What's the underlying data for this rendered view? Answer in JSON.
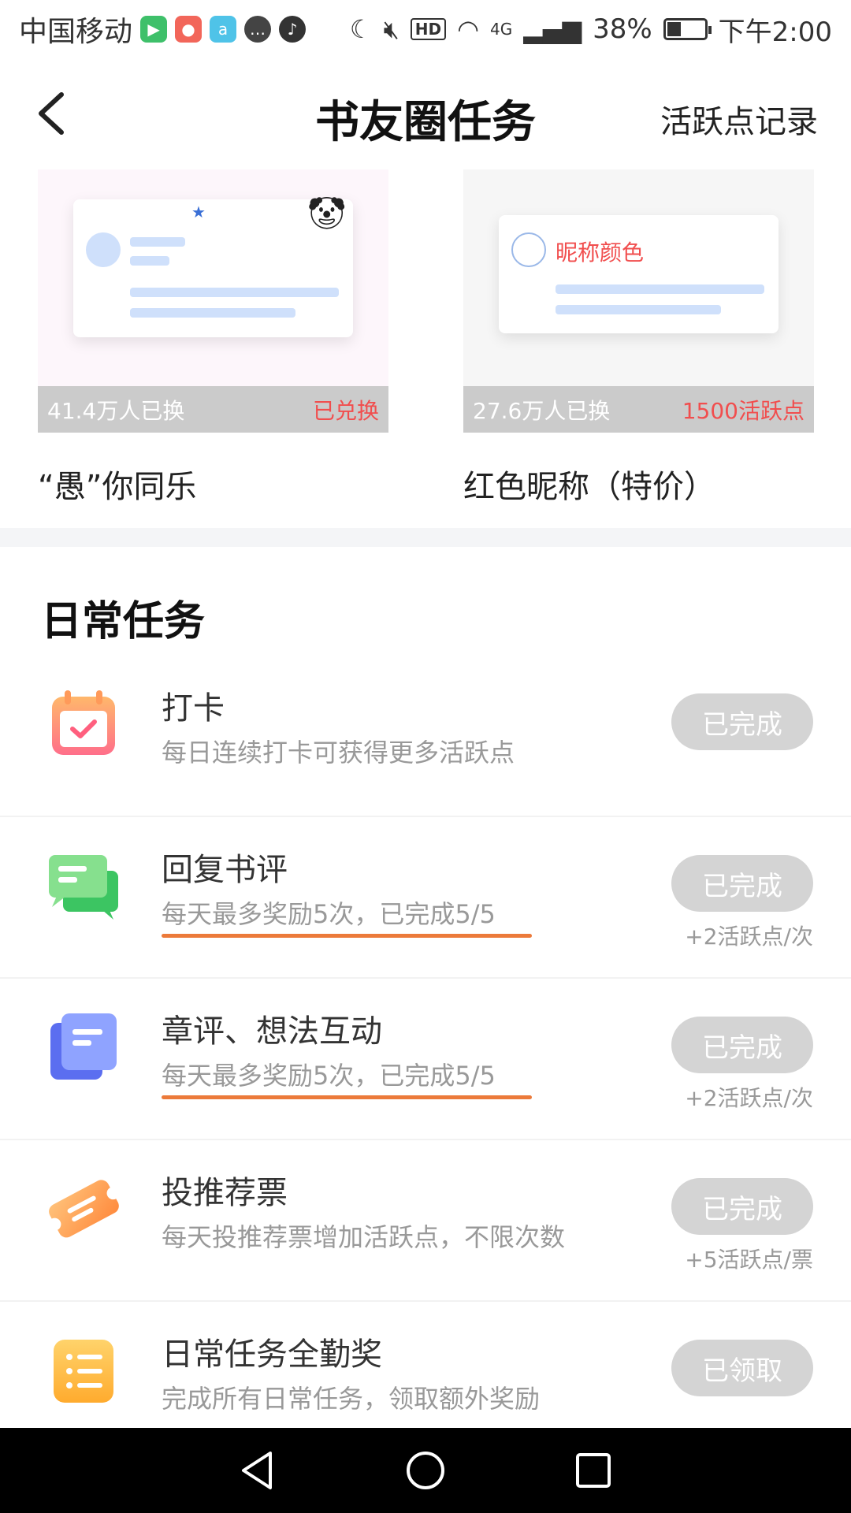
{
  "status_bar": {
    "carrier": "中国移动",
    "network": "4G",
    "battery": "38%",
    "battery_level": 0.38,
    "time": "下午2:00",
    "hd": "HD",
    "app_icons": [
      "video-app-icon",
      "red-app-icon",
      "aha-app-icon",
      "message-icon",
      "tiktok-icon"
    ]
  },
  "header": {
    "title": "书友圈任务",
    "record_link": "活跃点记录"
  },
  "rewards": [
    {
      "preview_label": "",
      "count": "41.4万人已换",
      "status": "已兑换",
      "name": "“愚”你同乐"
    },
    {
      "preview_label": "昵称颜色",
      "count": "27.6万人已换",
      "status": "1500活跃点",
      "name": "红色昵称（特价）"
    }
  ],
  "daily": {
    "title": "日常任务",
    "tasks": [
      {
        "name": "打卡",
        "desc": "每日连续打卡可获得更多活跃点",
        "button": "已完成",
        "reward": "",
        "icon": "calendar-check-icon"
      },
      {
        "name": "回复书评",
        "desc": "每天最多奖励5次，已完成5/5",
        "button": "已完成",
        "reward": "+2活跃点/次",
        "icon": "chat-bubbles-icon"
      },
      {
        "name": "章评、想法互动",
        "desc": "每天最多奖励5次，已完成5/5",
        "button": "已完成",
        "reward": "+2活跃点/次",
        "icon": "document-stack-icon"
      },
      {
        "name": "投推荐票",
        "desc": "每天投推荐票增加活跃点，不限次数",
        "button": "已完成",
        "reward": "+5活跃点/票",
        "icon": "ticket-icon"
      },
      {
        "name": "日常任务全勤奖",
        "desc": "完成所有日常任务，领取额外奖励",
        "button": "已领取",
        "reward": "",
        "icon": "list-icon"
      }
    ]
  },
  "colors": {
    "accent_red": "#f14e4e",
    "button_gray": "#d4d4d4",
    "underline_orange": "#ec7a3a"
  }
}
